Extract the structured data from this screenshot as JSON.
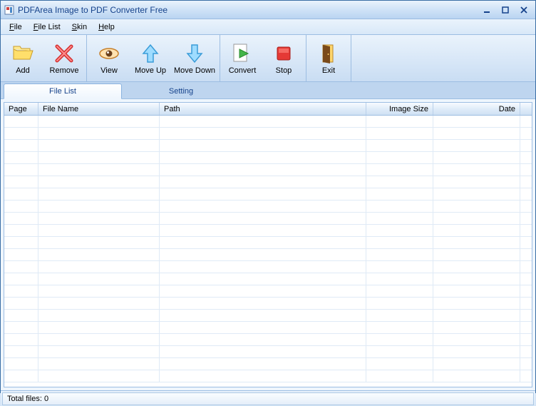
{
  "window": {
    "title": "PDFArea Image to PDF Converter Free"
  },
  "menu": {
    "items": [
      {
        "mnemonic": "F",
        "rest": "ile"
      },
      {
        "mnemonic": "F",
        "rest": "ile List"
      },
      {
        "mnemonic": "S",
        "rest": "kin"
      },
      {
        "mnemonic": "H",
        "rest": "elp"
      }
    ]
  },
  "toolbar": {
    "add": "Add",
    "remove": "Remove",
    "view": "View",
    "moveup": "Move Up",
    "movedown": "Move Down",
    "convert": "Convert",
    "stop": "Stop",
    "exit": "Exit"
  },
  "tabs": {
    "filelist": "File List",
    "setting": "Setting"
  },
  "columns": {
    "page": "Page",
    "filename": "File Name",
    "path": "Path",
    "imagesize": "Image Size",
    "date": "Date"
  },
  "status": {
    "text": "Total files: 0"
  }
}
